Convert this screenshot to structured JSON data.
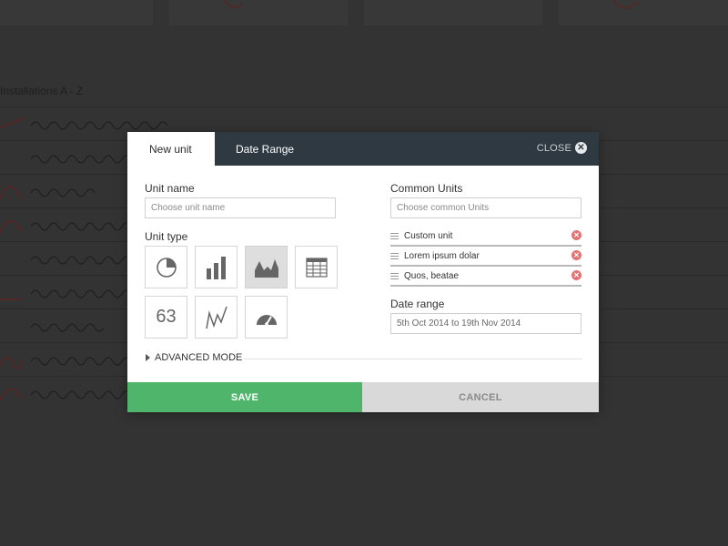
{
  "background": {
    "list_title": "Installations A - Z",
    "row_count": 9
  },
  "modal": {
    "tabs": [
      {
        "label": "New unit",
        "active": true
      },
      {
        "label": "Date Range",
        "active": false
      }
    ],
    "close_label": "CLOSE",
    "close_icon": "close-circle-icon",
    "unit_name": {
      "label": "Unit name",
      "placeholder": "Choose unit name",
      "value": ""
    },
    "unit_type": {
      "label": "Unit type",
      "options": [
        {
          "icon": "pie-chart-icon",
          "selected": false
        },
        {
          "icon": "bar-chart-icon",
          "selected": false
        },
        {
          "icon": "area-chart-icon",
          "selected": true
        },
        {
          "icon": "table-icon",
          "selected": false
        },
        {
          "icon": "number-icon",
          "text": "63",
          "selected": false
        },
        {
          "icon": "line-chart-icon",
          "selected": false
        },
        {
          "icon": "gauge-icon",
          "selected": false
        }
      ]
    },
    "common_units": {
      "label": "Common Units",
      "placeholder": "Choose common Units",
      "items": [
        {
          "name": "Custom unit"
        },
        {
          "name": "Lorem ipsum dolar"
        },
        {
          "name": "Quos, beatae"
        }
      ]
    },
    "date_range": {
      "label": "Date range",
      "value": "5th Oct 2014 to 19th Nov 2014"
    },
    "advanced_label": "ADVANCED MODE",
    "save_label": "SAVE",
    "cancel_label": "CANCEL",
    "colors": {
      "save": "#4fb56b",
      "cancel": "#d9d9d9",
      "header": "#2f3942",
      "remove": "#e57373"
    }
  }
}
